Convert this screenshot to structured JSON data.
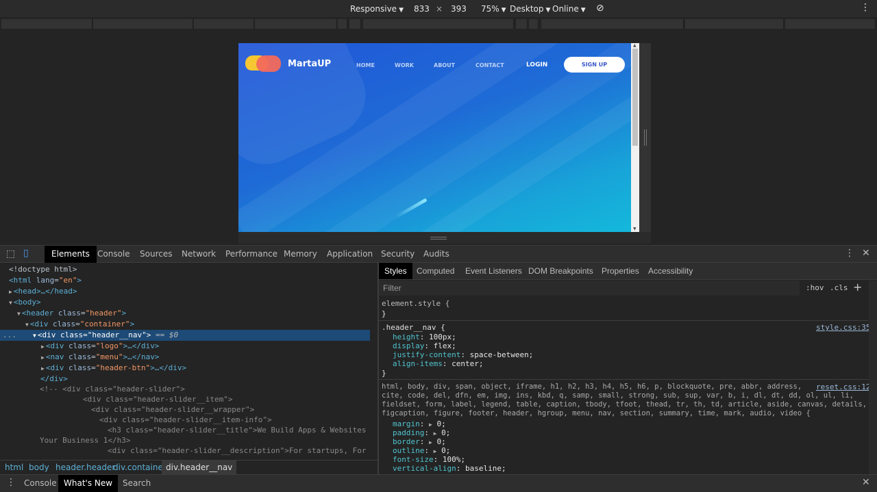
{
  "device_toolbar": {
    "mode": "Responsive",
    "width": "833",
    "times": "×",
    "height": "393",
    "zoom": "75%",
    "device_type": "Desktop",
    "throttle": "Online",
    "rotate_icon": "rotate-icon",
    "more_icon": "kebab-icon"
  },
  "preview": {
    "logo_text": "MartaUP",
    "nav": [
      "HOME",
      "WORK",
      "ABOUT",
      "CONTACT"
    ],
    "login": "LOGIN",
    "signup": "SIGN UP",
    "colors": {
      "gradient_start": "#2156d8",
      "gradient_end": "#14b8db",
      "logo_yellow": "#f7c633",
      "logo_red": "#f26a5d"
    }
  },
  "devtools_tabs": {
    "inspect_icon": "inspect-icon",
    "device_icon": "device-toggle-icon",
    "items": [
      "Elements",
      "Console",
      "Sources",
      "Network",
      "Performance",
      "Memory",
      "Application",
      "Security",
      "Audits"
    ],
    "active": "Elements"
  },
  "dom": {
    "doctype": "<!doctype html>",
    "html_open_tag": "<html",
    "lang_attr": "lang",
    "lang_val": "\"en\"",
    "head": "<head>…</head>",
    "body": "<body>",
    "header_tag": "<header",
    "class_attr": "class",
    "header_class": "\"header\"",
    "div_tag": "<div",
    "container_class": "\"container\"",
    "header_nav_class": "\"header__nav\"",
    "selected_suffix": "== $0",
    "logo_class": "\"logo\"",
    "nav_tag": "<nav",
    "menu_class": "\"menu\"",
    "header_btn_class": "\"header-btn\"",
    "collapsed_div": ">…</div>",
    "collapsed_nav": ">…</nav>",
    "close_div": "</div>",
    "close_gt": ">",
    "comment_lines": [
      "<!-- <div class=\"header-slider\">",
      "<div class=\"header-slider__item\">",
      "<div class=\"header-slider__wrapper\">",
      "<div class=\"header-slider__item-info\">",
      "<h3 class=\"header-slider__title\">We Build Apps & Websites for",
      "Your Business 1</h3>",
      "<div class=\"header-slider__description\">For startups, For"
    ],
    "ellipsis": "..."
  },
  "breadcrumbs": [
    "html",
    "body",
    "header.header",
    "div.container",
    "div.header__nav"
  ],
  "styles_tabs": {
    "items": [
      "Styles",
      "Computed",
      "Event Listeners",
      "DOM Breakpoints",
      "Properties",
      "Accessibility"
    ],
    "active": "Styles"
  },
  "styles": {
    "filter_placeholder": "Filter",
    "hov": ":hov",
    "cls": ".cls",
    "plus": "+",
    "element_style": "element.style {",
    "close_brace": "}",
    "rule1": {
      "selector": ".header__nav {",
      "source": "style.css:35",
      "props": [
        {
          "name": "height",
          "value": "100px;"
        },
        {
          "name": "display",
          "value": "flex;"
        },
        {
          "name": "justify-content",
          "value": "space-between;"
        },
        {
          "name": "align-items",
          "value": "center;"
        }
      ]
    },
    "rule2": {
      "source": "reset.css:12",
      "selector_lines": [
        "html, body, div, span, object, iframe, h1, h2, h3, h4, h5, h6, p, blockquote, pre, abbr, address,",
        "cite, code, del, dfn, em, img, ins, kbd, q, samp, small, strong, sub, sup, var, b, i, dl, dt, dd, ol, ul, li,",
        "fieldset, form, label, legend, table, caption, tbody, tfoot, thead, tr, th, td, article, aside, canvas, details,",
        "figcaption, figure, footer, header, hgroup, menu, nav, section, summary, time, mark, audio, video {"
      ],
      "props": [
        {
          "name": "margin",
          "value": "0;"
        },
        {
          "name": "padding",
          "value": "0;"
        },
        {
          "name": "border",
          "value": "0;"
        },
        {
          "name": "outline",
          "value": "0;"
        },
        {
          "name": "font-size",
          "value": "100%;"
        },
        {
          "name": "vertical-align",
          "value": "baseline;"
        }
      ]
    }
  },
  "drawer": {
    "menu_icon": "kebab-icon",
    "items": [
      "Console",
      "What's New",
      "Search"
    ],
    "active": "What's New"
  }
}
